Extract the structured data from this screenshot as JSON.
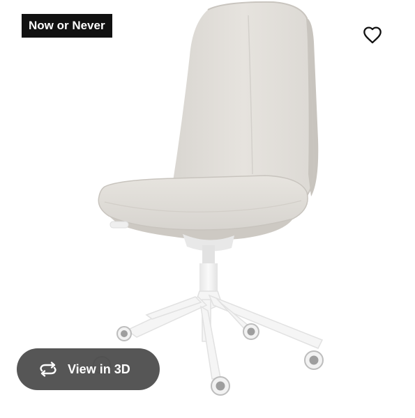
{
  "product": {
    "badge_label": "Now or Never",
    "image_subject": "office-swivel-chair",
    "colors": {
      "upholstery": "#e4e1dc",
      "frame": "#f4f4f4",
      "badge_background": "#111111",
      "view3d_background": "#484848"
    }
  },
  "actions": {
    "favorite_icon": "heart-outline-icon",
    "view3d_icon": "rotate-3d-icon",
    "view3d_label": "View in 3D"
  }
}
